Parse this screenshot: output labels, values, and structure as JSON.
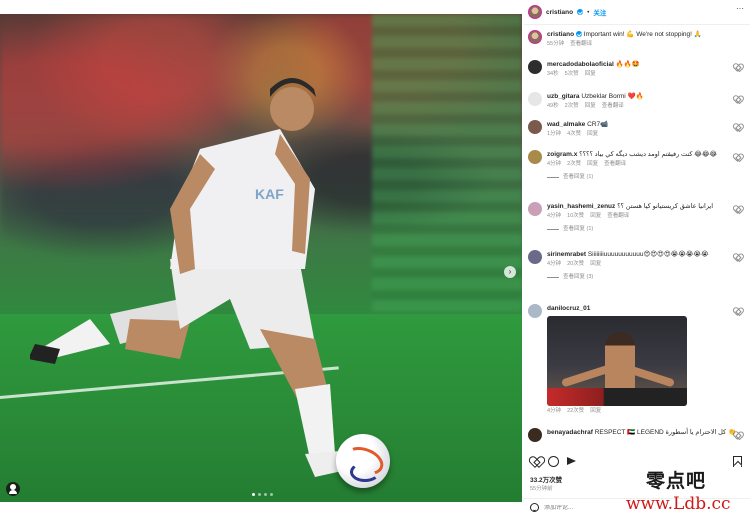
{
  "post": {
    "author": "cristiano",
    "follow_label": "关注",
    "caption": "Important win! 💪 We're not stopping! 🙏",
    "caption_time": "55分钟",
    "caption_translate": "查看翻译",
    "likes": "33.2万次赞",
    "time": "55分钟前",
    "comment_placeholder": "添加评论...",
    "carousel": {
      "count": 4,
      "active_index": 0
    }
  },
  "comments": [
    {
      "user": "mercadodabolaoficial",
      "text": "🔥🔥🤩",
      "time": "34秒",
      "likes": "5次赞",
      "reply": "回复",
      "translate": ""
    },
    {
      "user": "uzb_gitara",
      "text": "Uzbeklar Bormi ❤️🔥",
      "time": "49秒",
      "likes": "2次赞",
      "reply": "回复",
      "translate": "查看翻译"
    },
    {
      "user": "wad_almake",
      "text": "CR7📹",
      "time": "1分钟",
      "likes": "4次赞",
      "reply": "回复",
      "translate": ""
    },
    {
      "user": "zoigram.x",
      "text": "كنت رفيقتم اومد ديشب ديگه كي بياد ؟؟؟؟ 😂😂😂",
      "time": "4分钟",
      "likes": "2次赞",
      "reply": "回复",
      "translate": "查看翻译",
      "view_replies": "查看回复 (1)"
    },
    {
      "user": "yasin_hashemi_zenuz",
      "text": "ايرانيا عاشق كريستيانو كيا هستن ؟؟",
      "time": "4分钟",
      "likes": "10次赞",
      "reply": "回复",
      "translate": "查看翻译",
      "view_replies": "查看回复 (1)"
    },
    {
      "user": "sirinemrabet",
      "text": "Siiiiiiiiuuuuuuuuuuu😍😍😍😍😭😭😭😭😭",
      "time": "4分钟",
      "likes": "20次赞",
      "reply": "回复",
      "translate": "",
      "view_replies": "查看回复 (3)"
    },
    {
      "user": "danilocruz_01",
      "text": "",
      "time": "4分钟",
      "likes": "22次赞",
      "reply": "回复",
      "translate": ""
    },
    {
      "user": "benayadachraf",
      "text": "RESPECT 🇦🇪 LEGEND كل الاحترام يا أسطورة 👏",
      "time": "",
      "likes": "",
      "reply": "",
      "translate": ""
    }
  ],
  "watermark": {
    "cn": "零点吧",
    "url": "www.Ldb.cc"
  },
  "colors": {
    "accent": "#0095f6",
    "text": "#262626",
    "muted": "#8e8e8e",
    "watermark_red": "#d01818"
  },
  "icons": [
    "more-icon",
    "verified-icon",
    "heart-icon",
    "comment-icon",
    "share-icon",
    "save-icon",
    "emoji-icon",
    "tag-user-icon",
    "next-arrow-icon"
  ]
}
